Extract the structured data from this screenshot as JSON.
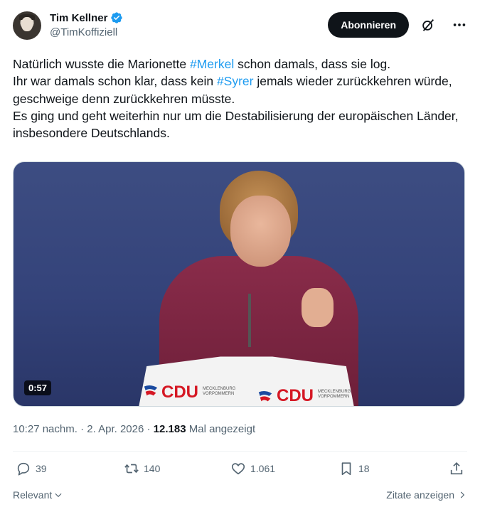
{
  "author": {
    "display_name": "Tim Kellner",
    "handle": "@TimKoffiziell",
    "verified_color": "#1d9bf0"
  },
  "header": {
    "subscribe_label": "Abonnieren"
  },
  "tweet": {
    "line1_pre": "Natürlich wusste die Marionette ",
    "hashtag1": "#Merkel",
    "line1_post": " schon damals, dass sie log.",
    "line2_pre": "Ihr war damals schon klar, dass kein ",
    "hashtag2": "#Syrer",
    "line2_post": " jemals wieder zurückkehren würde, geschweige denn zurückkehren müsste.",
    "line3": "Es ging und geht weiterhin nur um die Destabilisierung der europäischen Länder, insbesondere Deutschlands."
  },
  "media": {
    "duration": "0:57",
    "lectern_text": "CDU",
    "lectern_subtext": "MECKLENBURG VORPOMMERN"
  },
  "meta": {
    "time": "10:27 nachm.",
    "sep1": " · ",
    "date": "2. Apr. 2026",
    "sep2": " · ",
    "views": "12.183",
    "views_label": " Mal angezeigt"
  },
  "actions": {
    "replies": "39",
    "reposts": "140",
    "likes": "1.061",
    "bookmarks": "18"
  },
  "footer": {
    "sort_label": "Relevant",
    "quotes_label": "Zitate anzeigen"
  },
  "colors": {
    "accent": "#1d9bf0",
    "text": "#0f1419",
    "muted": "#536471"
  }
}
